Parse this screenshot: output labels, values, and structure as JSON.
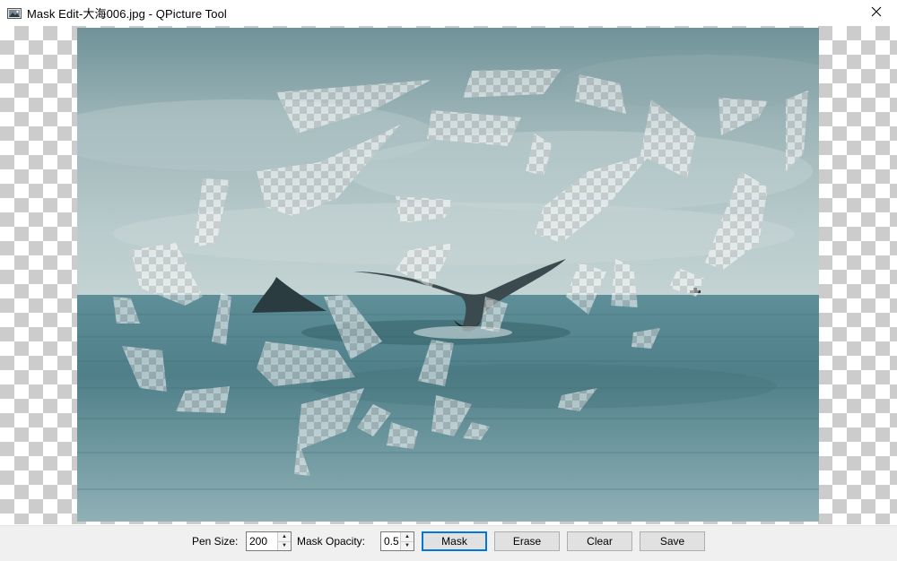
{
  "window": {
    "title": "Mask Edit-大海006.jpg - QPicture Tool",
    "app_icon": "picture-app-icon",
    "close_icon": "close-icon"
  },
  "canvas": {
    "background": "transparency-checkerboard",
    "image": "ocean-whale-tail-photo-with-mask"
  },
  "toolbar": {
    "pen_size_label": "Pen Size:",
    "pen_size_value": "200",
    "mask_opacity_label": "Mask Opacity:",
    "mask_opacity_value": "0.5",
    "mask_button": "Mask",
    "erase_button": "Erase",
    "clear_button": "Clear",
    "save_button": "Save"
  },
  "colors": {
    "accent_focus": "#0078d7",
    "toolbar_bg": "#f0f0f0",
    "button_bg": "#e1e1e1",
    "checker_dark": "#cccccc",
    "sea": "#5f8c95",
    "sky": "#9fb8bc"
  }
}
